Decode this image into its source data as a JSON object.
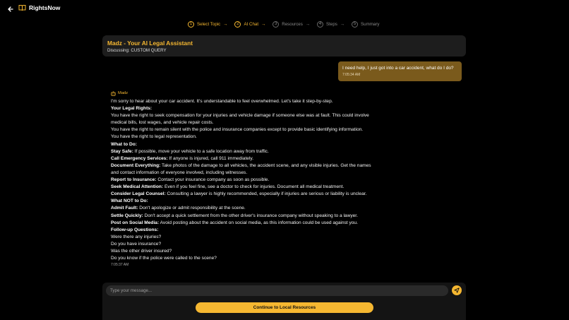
{
  "app": {
    "title": "RightsNow"
  },
  "steps": [
    {
      "num": "1",
      "label": "Select Topic"
    },
    {
      "num": "2",
      "label": "AI Chat"
    },
    {
      "num": "3",
      "label": "Resources"
    },
    {
      "num": "4",
      "label": "Steps"
    },
    {
      "num": "5",
      "label": "Summary"
    }
  ],
  "header": {
    "title": "Madz - Your AI Legal Assistant",
    "discussing": "Discussing: CUSTOM QUERY"
  },
  "user_message": {
    "text": "I need help, I just got into a car accident, what do I do?",
    "time": "7:05:34 AM"
  },
  "assistant": {
    "name": "Madz",
    "time": "7:05:37 AM",
    "lines": [
      {
        "b": "",
        "t": "I'm sorry to hear about your car accident. It's understandable to feel overwhelmed. Let's take it step-by-step."
      },
      {
        "b": "Your Legal Rights:",
        "t": ""
      },
      {
        "b": "",
        "t": "You have the right to seek compensation for your injuries and vehicle damage if someone else was at fault. This could involve"
      },
      {
        "b": "",
        "t": "medical bills, lost wages, and vehicle repair costs."
      },
      {
        "b": "",
        "t": "You have the right to remain silent with the police and insurance companies except to provide basic identifying information."
      },
      {
        "b": "",
        "t": "You have the right to legal representation."
      },
      {
        "b": "What to Do:",
        "t": ""
      },
      {
        "b": "Stay Safe:",
        "t": " If possible, move your vehicle to a safe location away from traffic."
      },
      {
        "b": "Call Emergency Services:",
        "t": " If anyone is injured, call 911 immediately."
      },
      {
        "b": "Document Everything:",
        "t": " Take photos of the damage to all vehicles, the accident scene, and any visible injuries. Get the names"
      },
      {
        "b": "",
        "t": "and contact information of everyone involved, including witnesses."
      },
      {
        "b": "Report to Insurance:",
        "t": " Contact your insurance company as soon as possible."
      },
      {
        "b": "Seek Medical Attention:",
        "t": " Even if you feel fine, see a doctor to check for injuries. Document all medical treatment."
      },
      {
        "b": "Consider Legal Counsel:",
        "t": " Consulting a lawyer is highly recommended, especially if injuries are serious or liability is unclear."
      },
      {
        "b": "What NOT to Do:",
        "t": ""
      },
      {
        "b": "Admit Fault:",
        "t": " Don't apologize or admit responsibility at the scene."
      },
      {
        "b": "Settle Quickly:",
        "t": " Don't accept a quick settlement from the other driver's insurance company without speaking to a lawyer."
      },
      {
        "b": "Post on Social Media:",
        "t": " Avoid posting about the accident on social media, as this information could be used against you."
      },
      {
        "b": "Follow-up Questions:",
        "t": ""
      },
      {
        "b": "",
        "t": "Were there any injuries?"
      },
      {
        "b": "",
        "t": "Do you have insurance?"
      },
      {
        "b": "",
        "t": "Was the other driver insured?"
      },
      {
        "b": "",
        "t": "Do you know if the police were called to the scene?"
      }
    ]
  },
  "composer": {
    "placeholder": "Type your message...",
    "continue_label": "Continue to Local Resources"
  },
  "icons": {
    "back": "arrow-left-icon",
    "brand": "book-icon",
    "assistant": "bot-icon",
    "send": "send-icon"
  },
  "colors": {
    "accent": "#f5b731",
    "user_bubble": "#7a5a1c",
    "card": "#1d1d1d",
    "background": "#000000"
  }
}
